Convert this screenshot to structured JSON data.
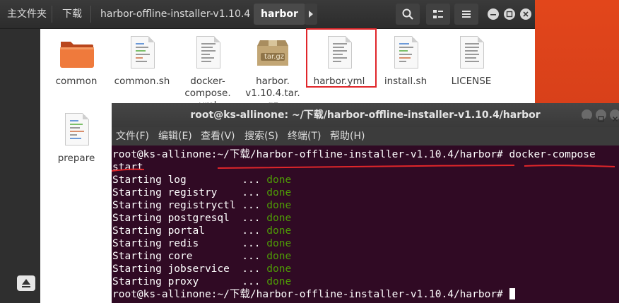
{
  "file_manager": {
    "breadcrumbs": [
      "主文件夹",
      "下载",
      "harbor-offline-installer-v1.10.4",
      "harbor"
    ],
    "files": [
      {
        "name": "common",
        "icon": "folder-icon"
      },
      {
        "name": "common.sh",
        "icon": "text-file-icon"
      },
      {
        "name": "docker-compose.yml",
        "label_lines": [
          "docker-",
          "compose.",
          "yml"
        ],
        "icon": "text-file-icon"
      },
      {
        "name": "harbor.v1.10.4.tar.gz",
        "label_lines": [
          "harbor.",
          "v1.10.4.tar.",
          "gz"
        ],
        "icon": "archive-icon",
        "badge": "tar.gz"
      },
      {
        "name": "harbor.yml",
        "icon": "text-file-icon",
        "highlighted": true
      },
      {
        "name": "install.sh",
        "icon": "text-file-icon"
      },
      {
        "name": "LICENSE",
        "icon": "text-file-icon"
      },
      {
        "name": "prepare",
        "icon": "text-file-icon"
      }
    ]
  },
  "terminal": {
    "title": "root@ks-allinone: ~/下载/harbor-offline-installer-v1.10.4/harbor",
    "menu": [
      "文件(F)",
      "编辑(E)",
      "查看(V)",
      "搜索(S)",
      "终端(T)",
      "帮助(H)"
    ],
    "prompt": "root@ks-allinone:~/下载/harbor-offline-installer-v1.10.4/harbor#",
    "command_line1": " docker-compose",
    "command_line2": "start",
    "output": [
      {
        "text": "Starting log         ... ",
        "status": "done"
      },
      {
        "text": "Starting registry    ... ",
        "status": "done"
      },
      {
        "text": "Starting registryctl ... ",
        "status": "done"
      },
      {
        "text": "Starting postgresql  ... ",
        "status": "done"
      },
      {
        "text": "Starting portal      ... ",
        "status": "done"
      },
      {
        "text": "Starting redis       ... ",
        "status": "done"
      },
      {
        "text": "Starting core        ... ",
        "status": "done"
      },
      {
        "text": "Starting jobservice  ... ",
        "status": "done"
      },
      {
        "text": "Starting proxy       ... ",
        "status": "done"
      }
    ],
    "final_prompt": "root@ks-allinone:~/下载/harbor-offline-installer-v1.10.4/harbor#"
  },
  "colors": {
    "terminal_bg": "#300a24",
    "done": "#4e9a06",
    "annotation": "#e0262a",
    "desktop": "#e9541f"
  }
}
